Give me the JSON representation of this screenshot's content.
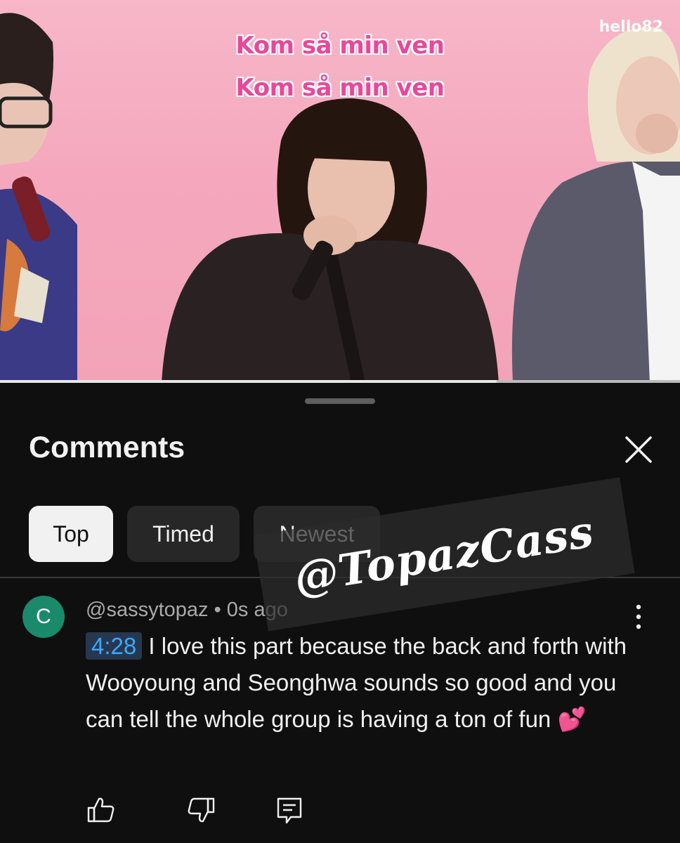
{
  "video": {
    "subtitle_line1": "Kom så min ven",
    "subtitle_line2": "Kom så min ven",
    "channel_logo": "hello82",
    "progress_fraction": 0.73
  },
  "comments_panel": {
    "title": "Comments",
    "close_icon": "close-icon",
    "filters": [
      {
        "label": "Top",
        "selected": true
      },
      {
        "label": "Timed",
        "selected": false
      },
      {
        "label": "Newest",
        "selected": false
      }
    ]
  },
  "watermark": {
    "text": "@TopazCass"
  },
  "comment": {
    "avatar_letter": "C",
    "avatar_color": "#1b8a6b",
    "author": "@sassytopaz",
    "separator": "•",
    "time_ago": "0s ago",
    "timestamp": "4:28",
    "text": "I love this part because the back and forth with Wooyoung and Seonghwa sounds so good and you can tell the whole group is having a ton of fun",
    "emoji": "💕",
    "actions": [
      "thumbs-up-icon",
      "thumbs-down-icon",
      "reply-icon"
    ]
  },
  "colors": {
    "background": "#0f0f0f",
    "chip_selected": "#f1f1f1",
    "chip": "#272727",
    "timestamp_link": "#3ea6ff",
    "subtitle": "#e8489a"
  }
}
